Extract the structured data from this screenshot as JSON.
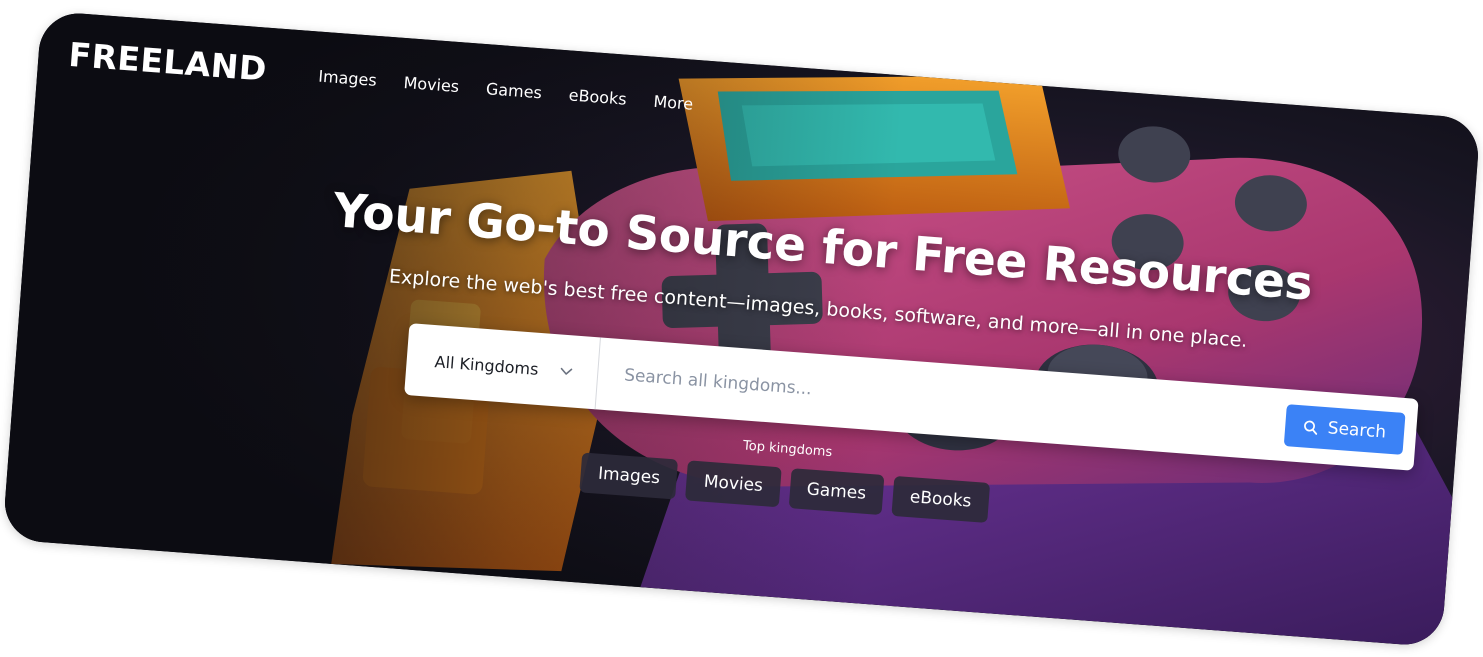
{
  "header": {
    "logo": "FREELAND",
    "nav": [
      "Images",
      "Movies",
      "Games",
      "eBooks",
      "More"
    ]
  },
  "hero": {
    "title": "Your Go-to Source for Free Resources",
    "subtitle": "Explore the web's best free content—images, books, software, and more—all in one place."
  },
  "search": {
    "kingdom_select": "All Kingdoms",
    "placeholder": "Search all kingdoms...",
    "button_label": "Search"
  },
  "top_kingdoms": {
    "label": "Top kingdoms",
    "items": [
      "Images",
      "Movies",
      "Games",
      "eBooks"
    ]
  },
  "colors": {
    "accent": "#3b82f6",
    "chip_bg": "#2c2a3a",
    "hero_dark": "#101018",
    "controller_pink": "#c2457f",
    "controller_orange": "#e58a1f",
    "controller_teal": "#2aa59c"
  },
  "icons": {
    "select": "chevron-down-icon",
    "search": "search-icon"
  }
}
